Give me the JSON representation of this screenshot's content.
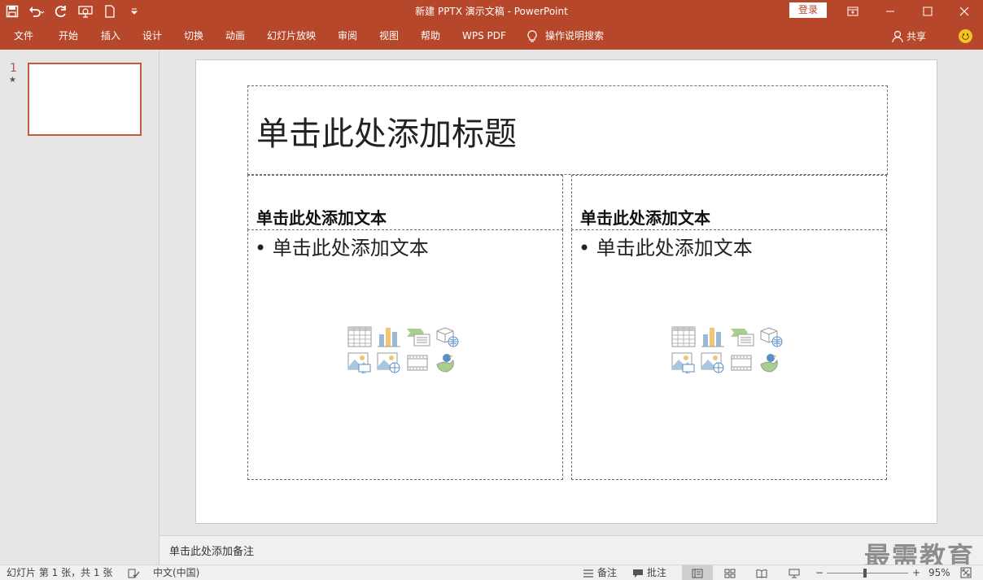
{
  "window": {
    "title": "新建 PPTX 演示文稿 - PowerPoint",
    "login_label": "登录"
  },
  "quick_access": {
    "icons": [
      "save-icon",
      "undo-icon",
      "redo-icon",
      "present-from-start-icon",
      "new-file-icon",
      "customize-qat-icon"
    ]
  },
  "ribbon": {
    "tabs": [
      "文件",
      "开始",
      "插入",
      "设计",
      "切换",
      "动画",
      "幻灯片放映",
      "审阅",
      "视图",
      "帮助",
      "WPS PDF"
    ],
    "tell_me": "操作说明搜索",
    "share_label": "共享"
  },
  "thumbnails": {
    "slide_number": "1",
    "star": "★"
  },
  "slide": {
    "title_placeholder": "单击此处添加标题",
    "left_heading": "单击此处添加文本",
    "right_heading": "单击此处添加文本",
    "left_body": "• 单击此处添加文本",
    "right_body": "• 单击此处添加文本"
  },
  "notes": {
    "placeholder": "单击此处添加备注",
    "watermark": "最需教育"
  },
  "status": {
    "slide_info": "幻灯片 第 1 张，共 1 张",
    "language": "中文(中国)",
    "notes_label": "备注",
    "comments_label": "批注",
    "zoom_minus": "−",
    "zoom_plus": "+",
    "zoom_level": "95%",
    "zoom_fraction": 0.95
  },
  "colors": {
    "accent": "#b7472a",
    "thumb_border": "#c55a3a"
  }
}
